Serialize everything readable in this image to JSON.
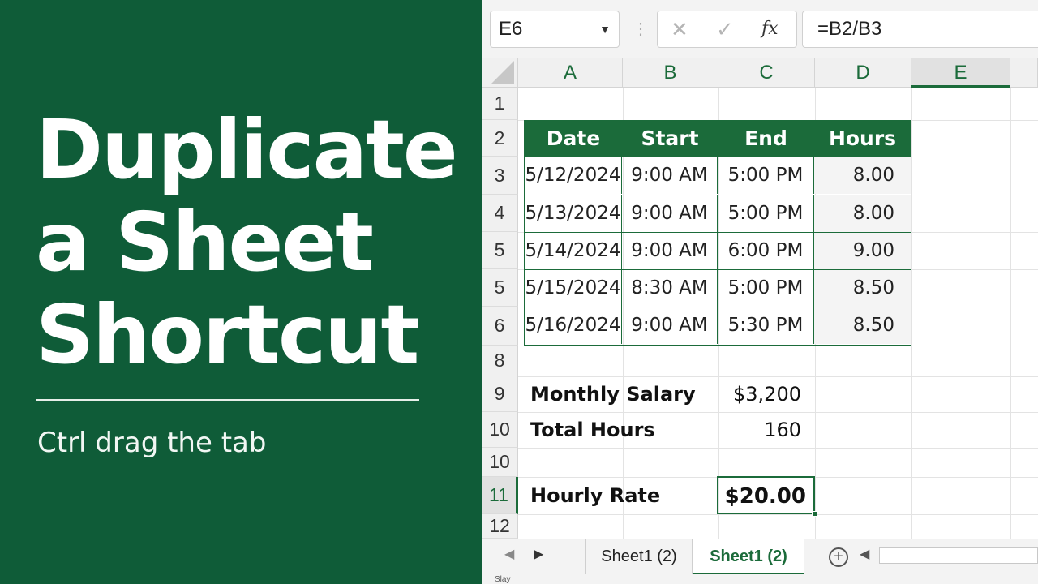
{
  "banner": {
    "title_lines": [
      "Duplicate",
      "a Sheet",
      "Shortcut"
    ],
    "subtitle": "Ctrl drag the tab"
  },
  "formula_bar": {
    "name_box": "E6",
    "cancel_icon": "✕",
    "enter_icon": "✓",
    "fx_label": "fx",
    "formula": "=B2/B3"
  },
  "columns": [
    "A",
    "B",
    "C",
    "D",
    "E"
  ],
  "rows": [
    "1",
    "2",
    "3",
    "4",
    "5",
    "5",
    "6",
    "8",
    "9",
    "10",
    "10",
    "11",
    "12"
  ],
  "table": {
    "headers": [
      "Date",
      "Start",
      "End",
      "Hours"
    ],
    "rows": [
      [
        "5/12/2024",
        "9:00 AM",
        "5:00 PM",
        "8.00"
      ],
      [
        "5/13/2024",
        "9:00 AM",
        "5:00 PM",
        "8.00"
      ],
      [
        "5/14/2024",
        "9:00 AM",
        "6:00 PM",
        "9.00"
      ],
      [
        "5/15/2024",
        "8:30 AM",
        "5:00 PM",
        "8.50"
      ],
      [
        "5/16/2024",
        "9:00 AM",
        "5:30 PM",
        "8.50"
      ]
    ]
  },
  "summary": {
    "salary_label": "Monthly Salary",
    "salary_value": "$3,200",
    "hours_label": "Total Hours",
    "hours_value": "160",
    "rate_label": "Hourly Rate",
    "rate_value": "$20.00"
  },
  "tabs": [
    "Sheet1 (2)",
    "Sheet1 (2)"
  ],
  "status": "Slay",
  "colors": {
    "brand_green": "#0f5c38",
    "excel_green": "#1b6b3a"
  }
}
